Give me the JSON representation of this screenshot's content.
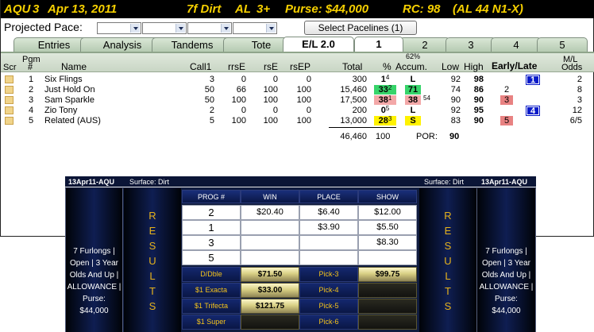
{
  "title_bar": {
    "track": "AQU",
    "race": "3",
    "date": "Apr 13, 2011",
    "distance_surface": "7f Dirt",
    "class": "AL",
    "age": "3+",
    "purse": "Purse: $44,000",
    "rc": "RC: 98",
    "rc_detail": "(AL 44 N1-X)"
  },
  "pace": {
    "label": "Projected Pace:",
    "select_button": "Select Pacelines  (1)"
  },
  "tabs": [
    {
      "label": "Entries"
    },
    {
      "label": "Analysis"
    },
    {
      "label": "Tandems"
    },
    {
      "label": "Tote"
    },
    {
      "label": "E/L 2.0"
    },
    {
      "label": "1"
    },
    {
      "label": "2"
    },
    {
      "label": "3"
    },
    {
      "label": "4"
    },
    {
      "label": "5"
    }
  ],
  "grid_headers": {
    "scr": "Scr",
    "pgm_top": "Pgm",
    "pgm_bottom": "#",
    "name": "Name",
    "call1": "Call1",
    "rrse": "rrsE",
    "rse": "rsE",
    "rsep": "rsEP",
    "total": "Total",
    "pct": "%",
    "accum_top": "62%",
    "accum": "Accum.",
    "low": "Low",
    "high": "High",
    "early_late": "Early/Late",
    "ml_top": "M/L",
    "ml_bottom": "Odds"
  },
  "entries": [
    {
      "pgm": "1",
      "name": "Six Flings",
      "call1": "3",
      "rrse": "0",
      "rse": "0",
      "rsep": "0",
      "total": "300",
      "pct": "1",
      "pct_sup": "4",
      "accum": "L",
      "accum_sup": "",
      "low": "92",
      "high": "98",
      "early": "",
      "late": "1",
      "odds": "2"
    },
    {
      "pgm": "2",
      "name": "Just Hold On",
      "call1": "50",
      "rrse": "66",
      "rse": "100",
      "rsep": "100",
      "total": "15,460",
      "pct": "33",
      "pct_sup": "2",
      "accum": "71",
      "accum_sup": "",
      "low": "74",
      "high": "86",
      "early": "2",
      "late": "",
      "odds": "8"
    },
    {
      "pgm": "3",
      "name": "Sam Sparkle",
      "call1": "50",
      "rrse": "100",
      "rse": "100",
      "rsep": "100",
      "total": "17,500",
      "pct": "38",
      "pct_sup": "1",
      "accum": "38",
      "accum_sup": "54",
      "low": "90",
      "high": "90",
      "early": "3",
      "late": "",
      "odds": "3"
    },
    {
      "pgm": "4",
      "name": "Zio Tony",
      "call1": "2",
      "rrse": "0",
      "rse": "0",
      "rsep": "0",
      "total": "200",
      "pct": "0",
      "pct_sup": "5",
      "accum": "L",
      "accum_sup": "",
      "low": "92",
      "high": "95",
      "early": "",
      "late": "4",
      "odds": "12"
    },
    {
      "pgm": "5",
      "name": "Related (AUS)",
      "call1": "5",
      "rrse": "100",
      "rse": "100",
      "rsep": "100",
      "total": "13,000",
      "pct": "28",
      "pct_sup": "3",
      "accum": "S",
      "accum_sup": "",
      "low": "83",
      "high": "90",
      "early": "5",
      "late": "",
      "odds": "6/5"
    }
  ],
  "totals": {
    "total": "46,460",
    "pct": "100",
    "por_label": "POR:",
    "por_value": "90"
  },
  "board": {
    "left_header": "13Apr11-AQU",
    "surface_left": "Surface: Dirt",
    "surface_right": "Surface: Dirt",
    "right_header": "13Apr11-AQU",
    "race_info_lines": [
      "7 Furlongs |",
      "Open | 3 Year",
      "Olds And Up |",
      "ALLOWANCE |",
      "Purse:",
      "$44,000"
    ],
    "results_letters": [
      "R",
      "E",
      "S",
      "U",
      "L",
      "T",
      "S"
    ],
    "col_headers": {
      "prog": "PROG #",
      "win": "WIN",
      "place": "PLACE",
      "show": "SHOW"
    },
    "finishers": [
      {
        "prog": "2",
        "win": "$20.40",
        "place": "$6.40",
        "show": "$12.00"
      },
      {
        "prog": "1",
        "win": "",
        "place": "$3.90",
        "show": "$5.50"
      },
      {
        "prog": "3",
        "win": "",
        "place": "",
        "show": "$8.30"
      },
      {
        "prog": "5",
        "win": "",
        "place": "",
        "show": ""
      }
    ],
    "exotics": [
      {
        "label": "D/Dble",
        "value": "$71.50",
        "label2": "Pick-3",
        "value2": "$99.75"
      },
      {
        "label": "$1 Exacta",
        "value": "$33.00",
        "label2": "Pick-4",
        "value2": ""
      },
      {
        "label": "$1 Trifecta",
        "value": "$121.75",
        "label2": "Pick-5",
        "value2": ""
      },
      {
        "label": "$1 Super",
        "value": "",
        "label2": "Pick-6",
        "value2": ""
      }
    ]
  },
  "colors": {
    "title_bg": "#000000",
    "title_text": "#f6d000",
    "accum_green": "#37d46a",
    "accum_pink": "#f3a8a8",
    "accum_yellow": "#fff200",
    "early_box": "#e88282",
    "late_box": "#0a1bc8",
    "board_bg": "#101c3f",
    "results_letters": "#e6b21a"
  }
}
